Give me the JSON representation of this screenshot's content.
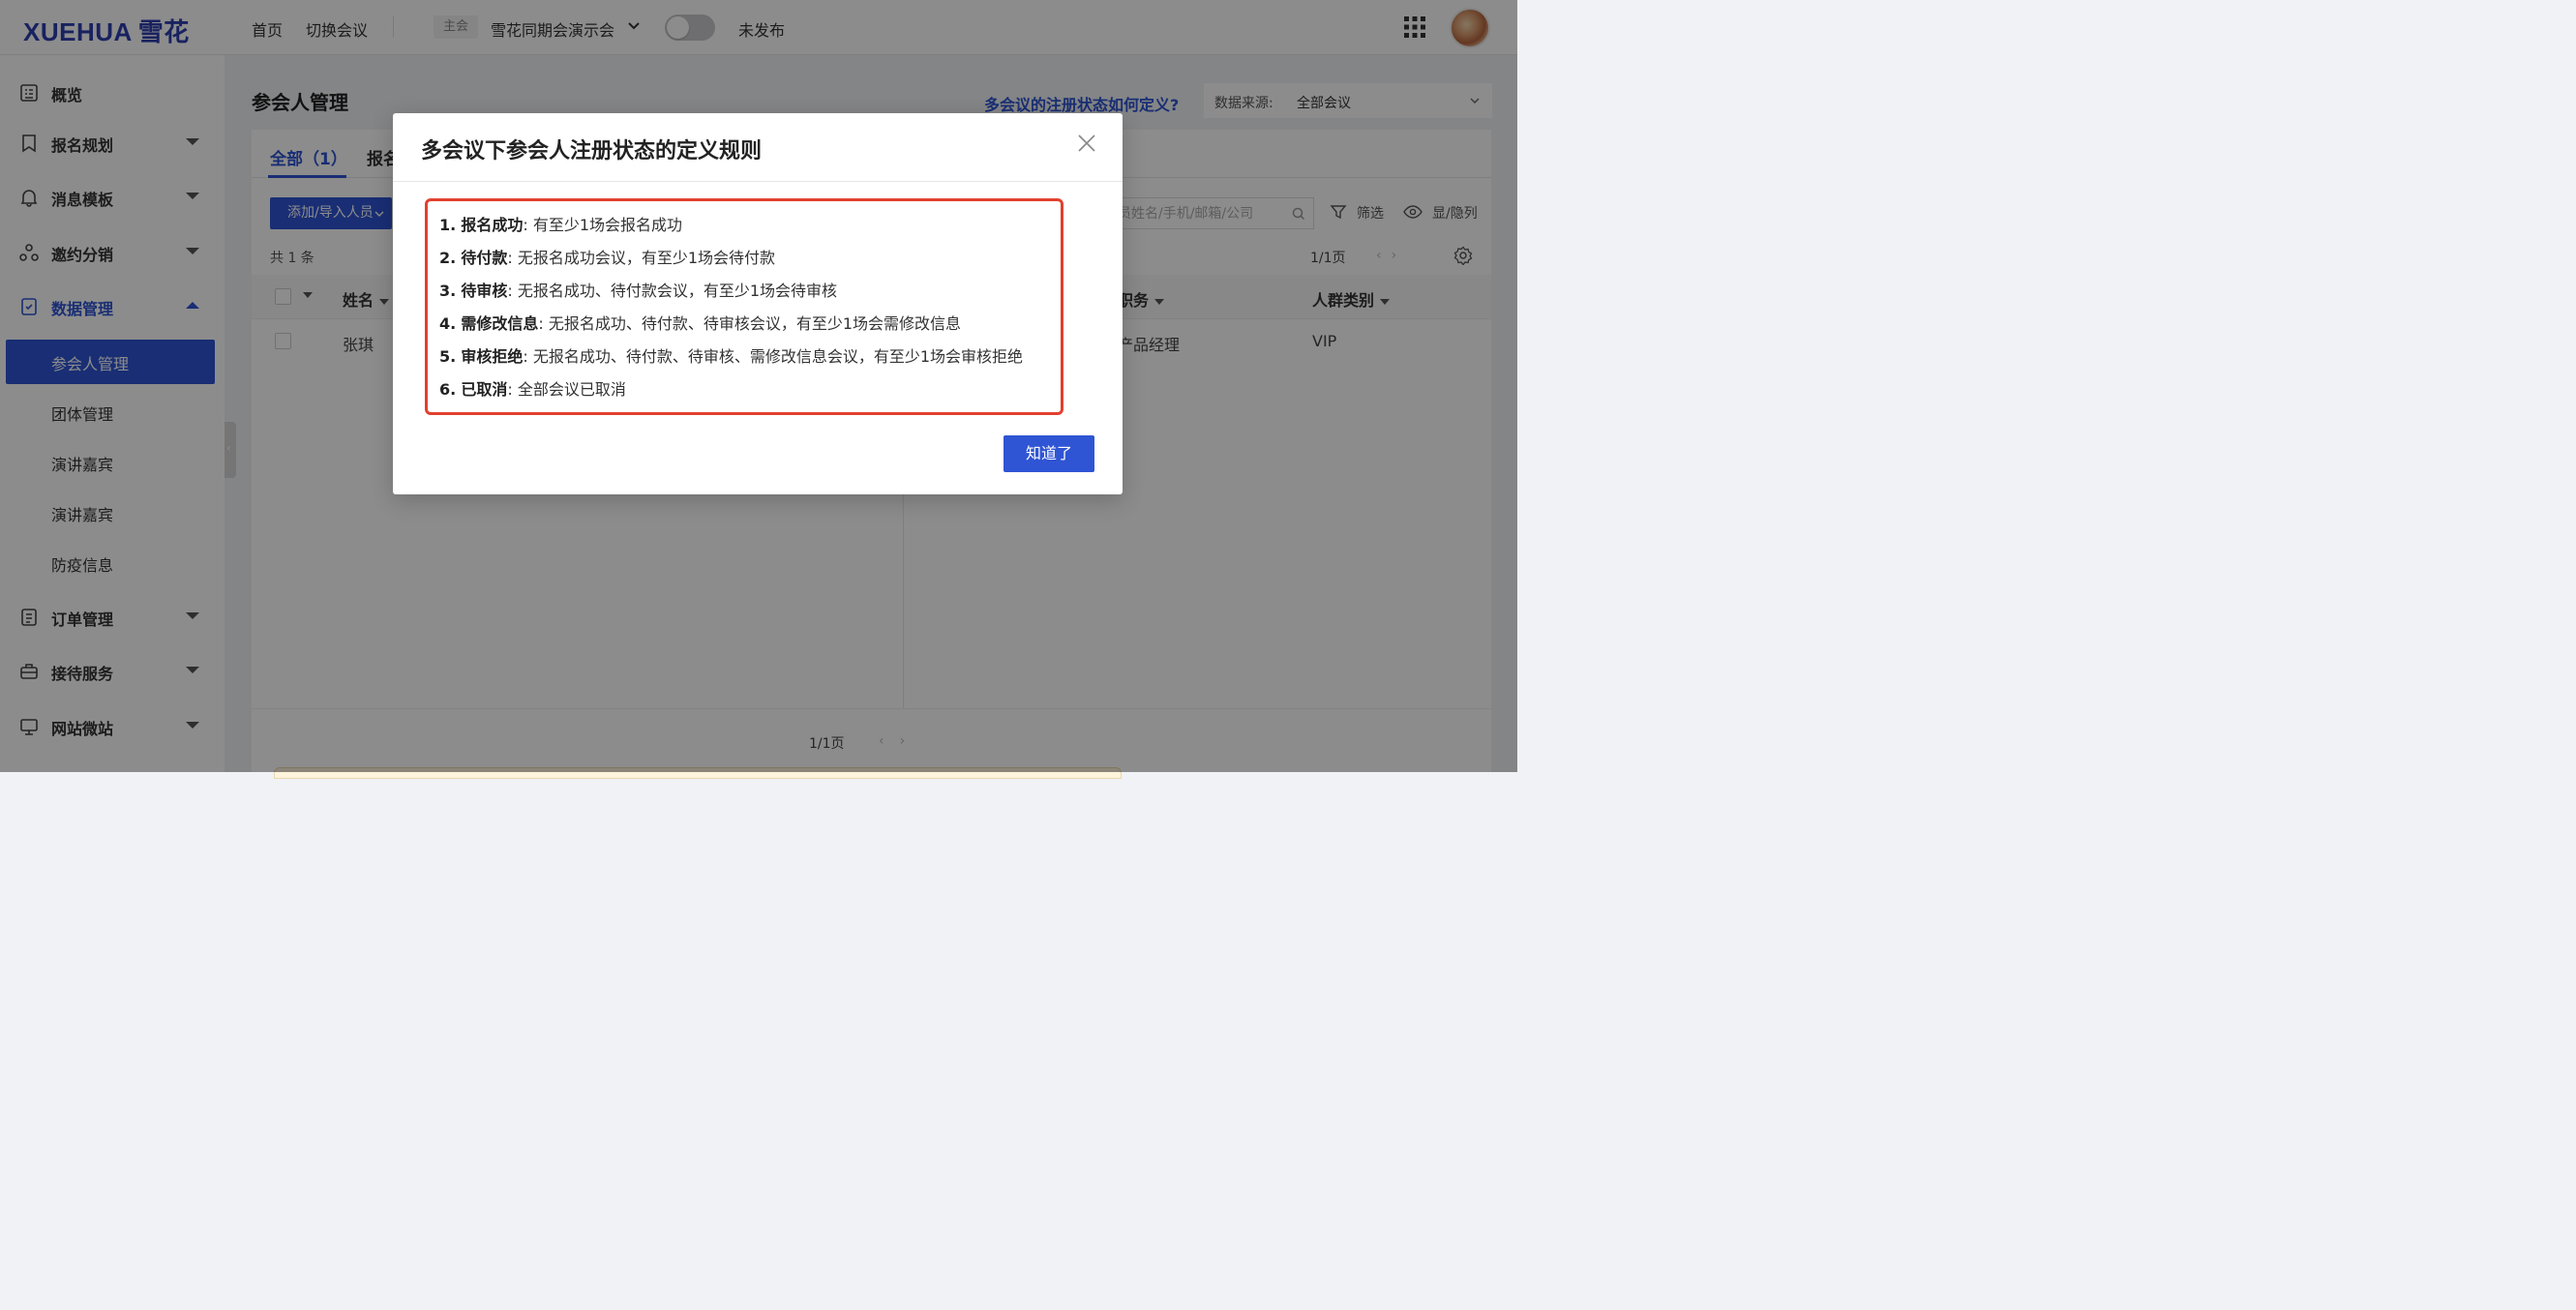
{
  "brand": {
    "logo_text": "XUEHUA",
    "logo_cn": "雪花"
  },
  "topnav": {
    "home": "首页",
    "switch_meeting": "切换会议",
    "badge_main": "主会",
    "conference_name": "雪花同期会演示会",
    "publish_status": "未发布",
    "apps_icon": "grid-apps-icon"
  },
  "sidebar": {
    "items": [
      {
        "label": "概览",
        "icon": "overview-icon"
      },
      {
        "label": "报名规划",
        "icon": "bookmark-icon"
      },
      {
        "label": "消息模板",
        "icon": "bell-icon"
      },
      {
        "label": "邀约分销",
        "icon": "share-icon"
      },
      {
        "label": "数据管理",
        "icon": "data-icon"
      },
      {
        "label": "订单管理",
        "icon": "order-icon"
      },
      {
        "label": "接待服务",
        "icon": "reception-icon"
      },
      {
        "label": "网站微站",
        "icon": "website-icon"
      }
    ],
    "subitems": [
      {
        "label": "参会人管理"
      },
      {
        "label": "团体管理"
      },
      {
        "label": "演讲嘉宾"
      },
      {
        "label": "演讲嘉宾"
      },
      {
        "label": "防疫信息"
      }
    ]
  },
  "main": {
    "page_title": "参会人管理",
    "help_link": "多会议的注册状态如何定义?",
    "source_label": "数据来源:",
    "source_value": "全部会议",
    "tabs": [
      {
        "label": "全部（1）"
      },
      {
        "label": "报名"
      }
    ],
    "add_button": "添加/导入人员",
    "count_text": "共 1 条",
    "search_placeholder": "人员姓名/手机/邮箱/公司",
    "filter_label": "筛选",
    "columns_label": "显/隐列",
    "pager_top": "1/1页",
    "pager_bottom": "1/1页",
    "table": {
      "headers": {
        "name": "姓名",
        "position": "职务",
        "group": "人群类别"
      },
      "rows": [
        {
          "name": "张琪",
          "position": "产品经理",
          "group": "VIP"
        }
      ]
    }
  },
  "modal": {
    "title": "多会议下参会人注册状态的定义规则",
    "rules": [
      {
        "num": "1.",
        "term": "报名成功",
        "sep": ":",
        "desc": "有至少1场会报名成功"
      },
      {
        "num": "2.",
        "term": "待付款",
        "sep": ":",
        "desc": "无报名成功会议，有至少1场会待付款"
      },
      {
        "num": "3.",
        "term": "待审核",
        "sep": ":",
        "desc": "无报名成功、待付款会议，有至少1场会待审核"
      },
      {
        "num": "4.",
        "term": "需修改信息",
        "sep": ":",
        "desc": "无报名成功、待付款、待审核会议，有至少1场会需修改信息"
      },
      {
        "num": "5.",
        "term": "审核拒绝",
        "sep": ":",
        "desc": "无报名成功、待付款、待审核、需修改信息会议，有至少1场会审核拒绝"
      },
      {
        "num": "6.",
        "term": "已取消",
        "sep": ":",
        "desc": "全部会议已取消"
      }
    ],
    "ok_button": "知道了"
  },
  "colors": {
    "primary": "#2f55d4",
    "logo": "#2f3fb0",
    "highlight_border": "#e2402f"
  }
}
